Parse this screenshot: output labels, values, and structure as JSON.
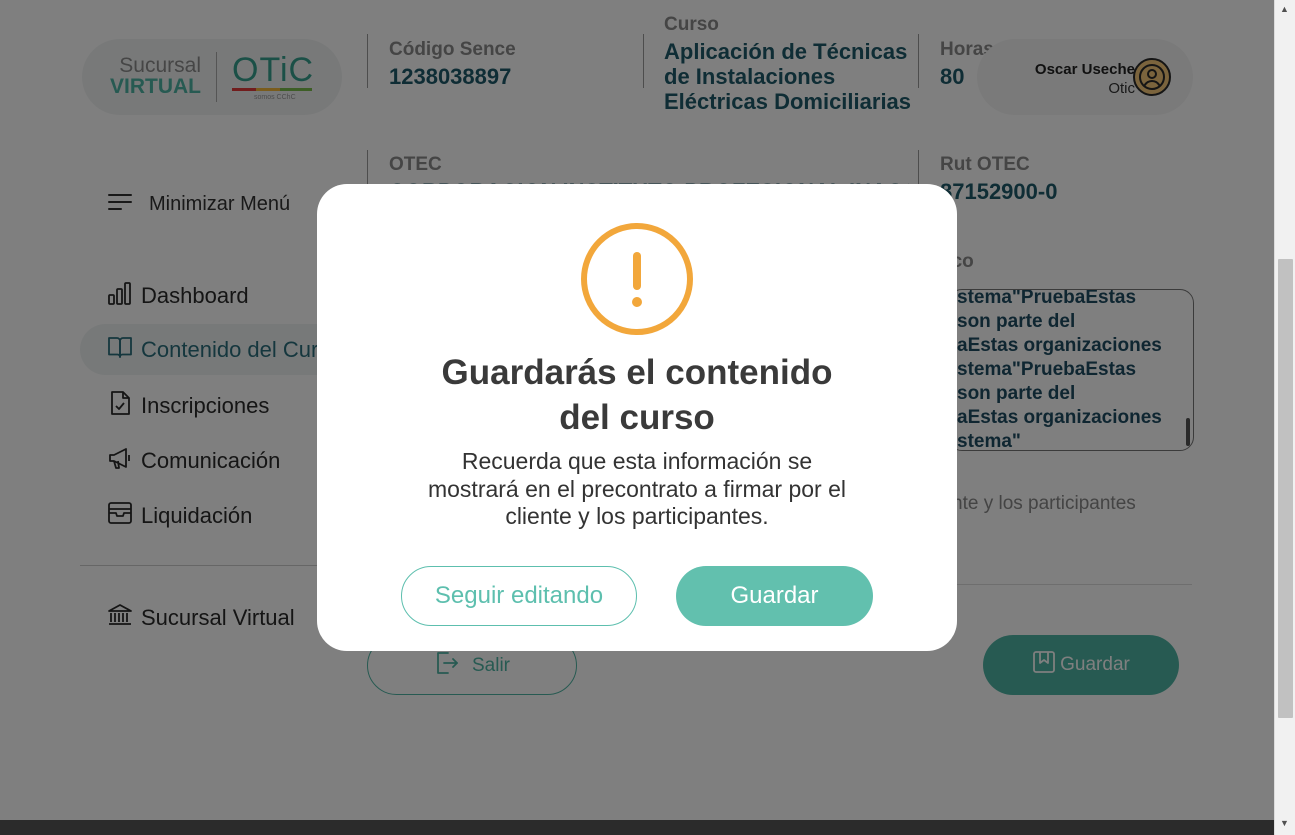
{
  "logo": {
    "line1": "Sucursal",
    "line2": "VIRTUAL",
    "brand": "OTiC",
    "tagline": "somos CChC"
  },
  "header": {
    "codigo_sence": {
      "label": "Código Sence",
      "value": "1238038897"
    },
    "curso": {
      "label": "Curso",
      "value": "Aplicación de Técnicas\nde Instalaciones\nEléctricas Domiciliarias"
    },
    "horas": {
      "label": "Horas",
      "value": "80"
    },
    "otec": {
      "label": "OTEC",
      "value": "CORPORACION INSTITUTO PROFESIONAL INACAP"
    },
    "rut_otec": {
      "label": "Rut OTEC",
      "value": "87152900-0"
    }
  },
  "user": {
    "name": "Oscar Useche",
    "role": "Otic",
    "icon": "user-circle-icon"
  },
  "sidebar": {
    "minimize_label": "Minimizar Menú",
    "items": [
      {
        "label": "Dashboard",
        "icon": "bar-chart-icon",
        "active": false
      },
      {
        "label": "Contenido del Cur",
        "icon": "book-icon",
        "active": true
      },
      {
        "label": "Inscripciones",
        "icon": "file-check-icon",
        "active": false
      },
      {
        "label": "Comunicación",
        "icon": "megaphone-icon",
        "active": false
      },
      {
        "label": "Liquidación",
        "icon": "archive-icon",
        "active": false
      }
    ],
    "footer_item": {
      "label": "Sucursal Virtual",
      "icon": "bank-icon"
    }
  },
  "content": {
    "section_label_partial": "tico",
    "textarea_text": "stema\"PruebaEstas\n son parte del\naEstas organizaciones\nstema\"PruebaEstas\n son parte del\naEstas organizaciones\nstema\"",
    "note_partial": "nte y los participantes",
    "salir_label": "Salir",
    "guardar_label": "Guardar"
  },
  "modal": {
    "icon": "warning-circle-icon",
    "title_line1": "Guardarás el contenido",
    "title_line2": "del curso",
    "body": "Recuerda que esta información se mostrará en el precontrato a firmar por el cliente y los participantes.",
    "secondary_button": "Seguir editando",
    "primary_button": "Guardar"
  },
  "colors": {
    "accent": "#62c0ae",
    "accent_dark": "#4fb5a4",
    "heading_blue": "#1e5a6a",
    "warning": "#f2a73b",
    "overlay": "rgba(0,0,0,0.5)"
  }
}
